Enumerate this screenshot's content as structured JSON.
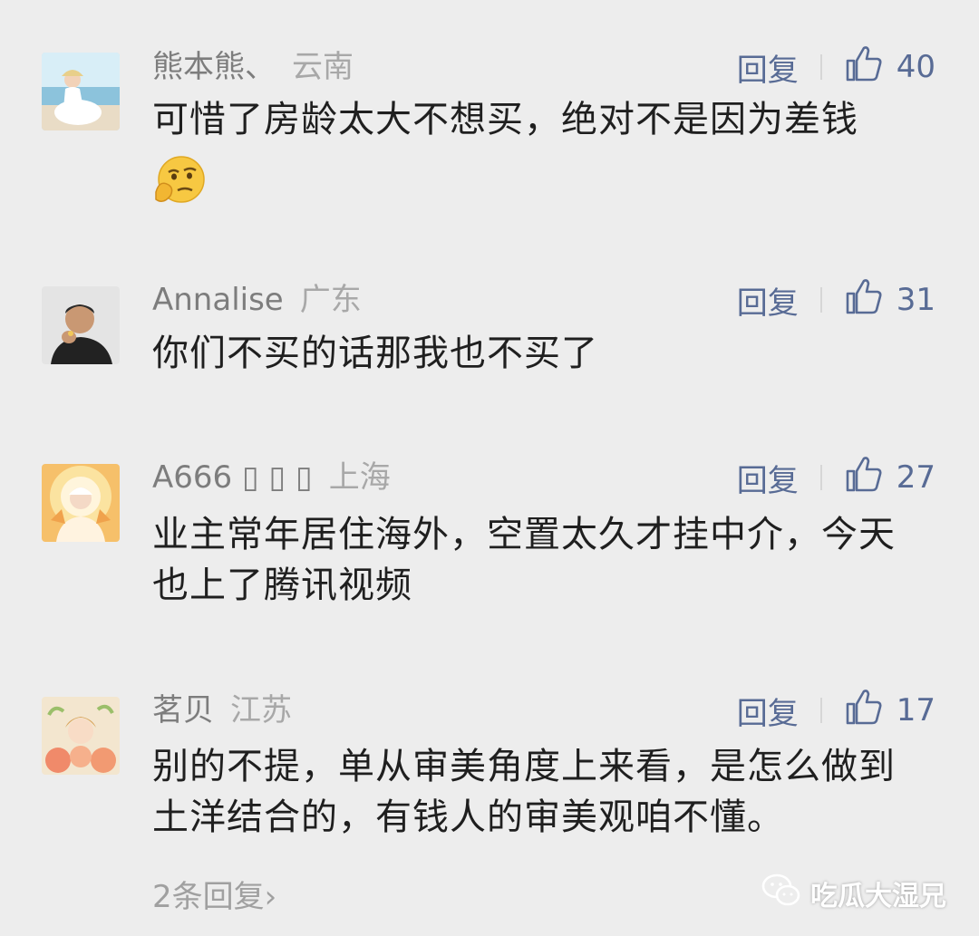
{
  "comments": [
    {
      "nickname": "熊本熊、",
      "location": "云南",
      "reply_label": "回复",
      "likes": "40",
      "text": "可惜了房龄太大不想买，绝对不是因为差钱",
      "has_emoji": true
    },
    {
      "nickname": "Annalise",
      "location": "广东",
      "reply_label": "回复",
      "likes": "31",
      "text": "你们不买的话那我也不买了"
    },
    {
      "nickname": "A666 ▯ ▯ ▯",
      "location": "上海",
      "reply_label": "回复",
      "likes": "27",
      "text": "业主常年居住海外，空置太久才挂中介，今天也上了腾讯视频"
    },
    {
      "nickname": "茗贝",
      "location": "江苏",
      "reply_label": "回复",
      "likes": "17",
      "text": "别的不提，单从审美角度上来看，是怎么做到土洋结合的，有钱人的审美观咱不懂。"
    }
  ],
  "more_replies": "2条回复",
  "watermark": "吃瓜大湿兄",
  "colors": {
    "background": "#ededed",
    "link": "#586b95",
    "text": "#1f1f1f"
  },
  "icons": [
    "thumbs-up-icon",
    "thinking-emoji-icon",
    "wechat-icon",
    "chevron-right-icon"
  ]
}
